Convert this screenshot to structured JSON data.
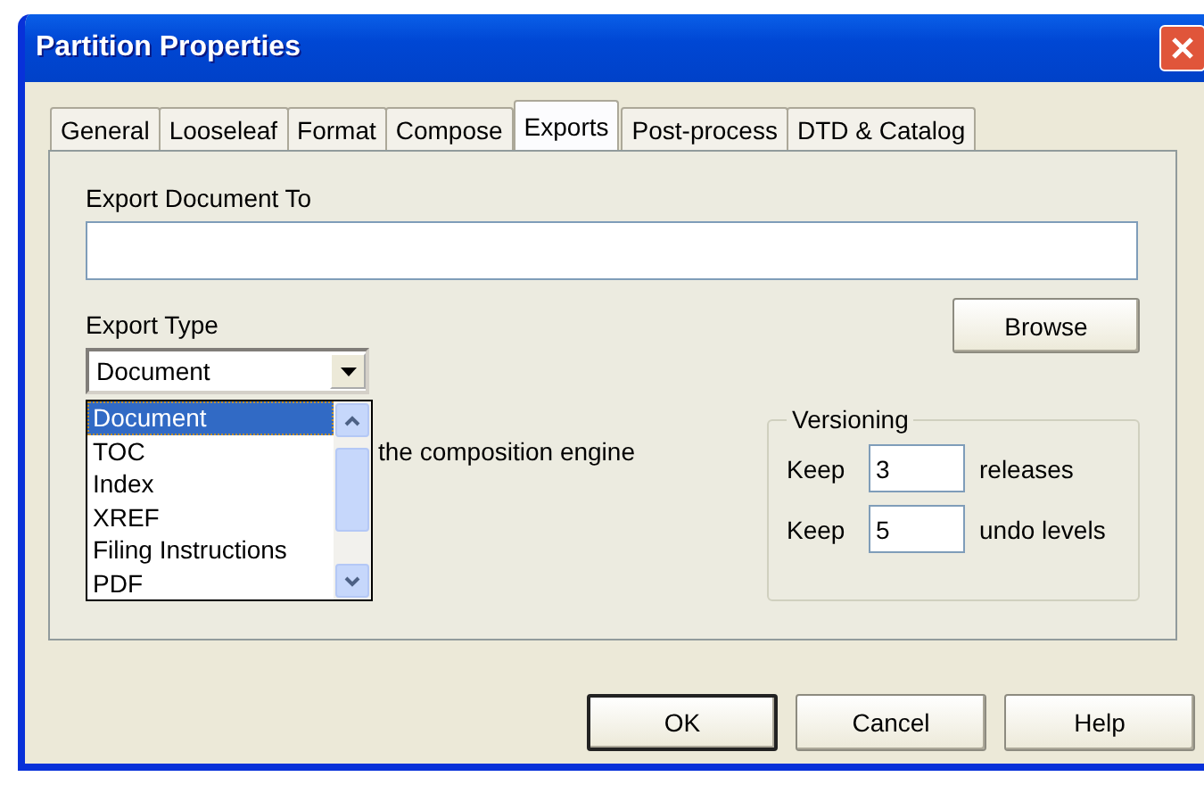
{
  "window": {
    "title": "Partition Properties"
  },
  "tabs": [
    {
      "label": "General",
      "selected": false
    },
    {
      "label": "Looseleaf",
      "selected": false
    },
    {
      "label": "Format",
      "selected": false
    },
    {
      "label": "Compose",
      "selected": false
    },
    {
      "label": "Exports",
      "selected": true
    },
    {
      "label": "Post-process",
      "selected": false
    },
    {
      "label": "DTD & Catalog",
      "selected": false
    }
  ],
  "export_to": {
    "label": "Export Document To"
  },
  "browse_button": "Browse",
  "export_type": {
    "label": "Export Type",
    "value": "Document",
    "options": [
      {
        "label": "Document",
        "selected": true
      },
      {
        "label": "TOC",
        "selected": false
      },
      {
        "label": "Index",
        "selected": false
      },
      {
        "label": "XREF",
        "selected": false
      },
      {
        "label": "Filing Instructions",
        "selected": false
      },
      {
        "label": "PDF",
        "selected": false
      }
    ]
  },
  "partly_hidden_text": "the composition engine",
  "versioning": {
    "title": "Versioning",
    "rows": [
      {
        "prefix": "Keep",
        "value": "3",
        "suffix": "releases"
      },
      {
        "prefix": "Keep",
        "value": "5",
        "suffix": "undo levels"
      }
    ]
  },
  "buttons": [
    {
      "label": "OK",
      "default": true
    },
    {
      "label": "Cancel",
      "default": false
    },
    {
      "label": "Help",
      "default": false
    }
  ]
}
